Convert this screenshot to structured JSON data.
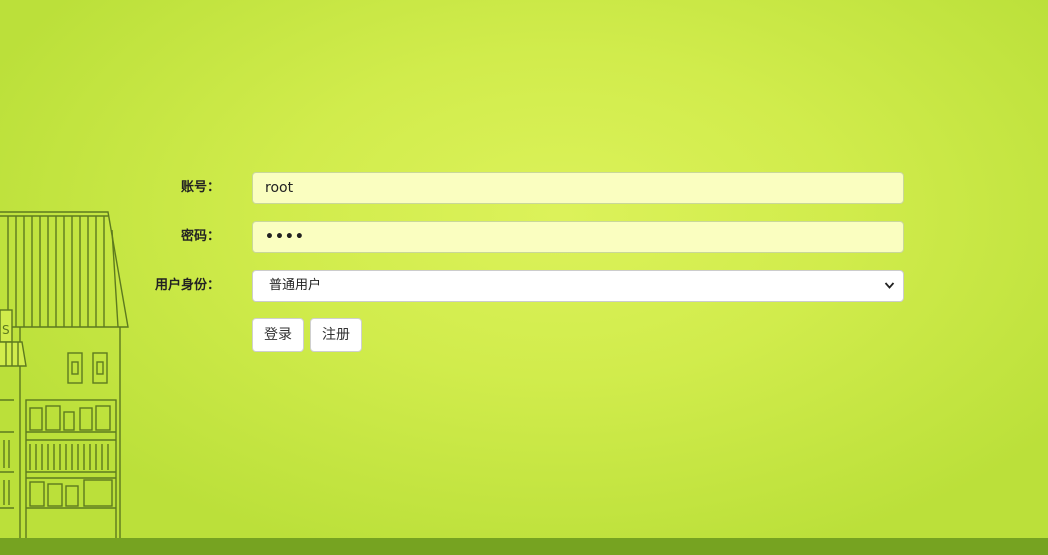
{
  "form": {
    "account_label": "账号：",
    "account_value": "root",
    "password_label": "密码：",
    "password_value": "••••",
    "role_label": "用户身份：",
    "role_selected": "普通用户"
  },
  "buttons": {
    "login": "登录",
    "register": "注册"
  },
  "colors": {
    "background": "#d1ec4c",
    "input_fill": "#fafec0",
    "ground": "#76a321",
    "house_line": "#5d7a1f"
  },
  "icons": {
    "select_arrow": "chevron-down-icon",
    "decoration": "bookstore-house-icon"
  }
}
